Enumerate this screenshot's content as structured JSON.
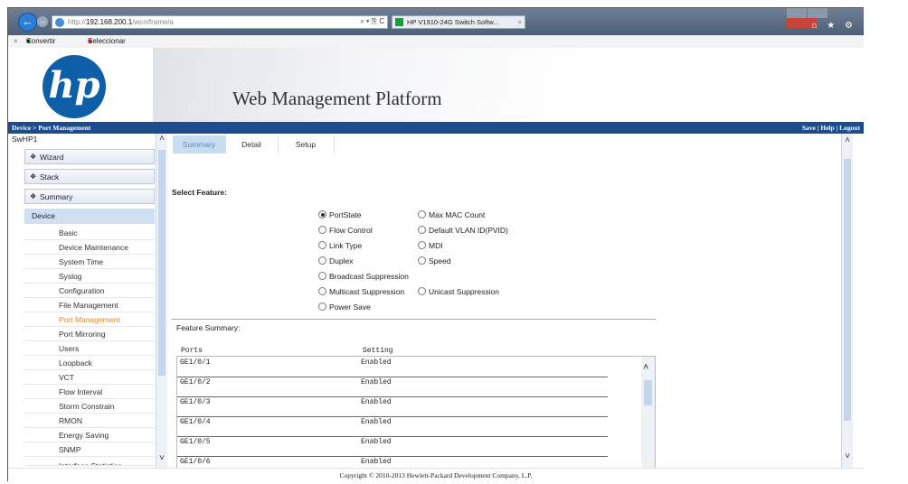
{
  "browser": {
    "url_prefix": "http://",
    "url_host": "192.168.200.1",
    "url_path": "/wcn/frame/a",
    "address_tools": "⌕ ▾ ⎘ C",
    "tab_title": "HP V1910-24G Switch Softw...",
    "tab_close": "×",
    "right_icons": "⌂ ★ ⚙",
    "toolbar_close": "×",
    "toolbar_convert": "Convertir",
    "toolbar_convert_arrow": "▾",
    "toolbar_select": "Seleccionar"
  },
  "header": {
    "logo_text": "hp",
    "title": "Web Management Platform"
  },
  "navbar": {
    "breadcrumb": "Device > Port Management",
    "links": "Save | Help | Logout"
  },
  "sidebar": {
    "device_name": "SwHP1",
    "groups": [
      "Wizard",
      "Stack",
      "Summary"
    ],
    "device_header": "Device",
    "items": [
      "Basic",
      "Device Maintenance",
      "System Time",
      "Syslog",
      "Configuration",
      "File Management",
      "Port Management",
      "Port Mirroring",
      "Users",
      "Loopback",
      "VCT",
      "Flow Interval",
      "Storm Constrain",
      "RMON",
      "Energy Saving",
      "SNMP",
      "Interface Statistics"
    ],
    "active_item": "Port Management"
  },
  "main": {
    "tabs": [
      "Summary",
      "Detail",
      "Setup"
    ],
    "active_tab": "Summary",
    "select_feature_label": "Select Feature:",
    "options_left": [
      "PortState",
      "Flow Control",
      "Link Type",
      "Duplex",
      "Broadcast Suppression",
      "Multicast Suppression",
      "Power Save"
    ],
    "options_right": [
      "Max MAC Count",
      "Default VLAN ID(PVID)",
      "MDI",
      "Speed",
      "",
      "Unicast Suppression"
    ],
    "selected_option": "PortState",
    "feature_summary_label": "Feature Summary:",
    "columns": [
      "Ports",
      "Setting"
    ],
    "rows": [
      {
        "port": "GE1/0/1",
        "setting": "Enabled"
      },
      {
        "port": "GE1/0/2",
        "setting": "Enabled"
      },
      {
        "port": "GE1/0/3",
        "setting": "Enabled"
      },
      {
        "port": "GE1/0/4",
        "setting": "Enabled"
      },
      {
        "port": "GE1/0/5",
        "setting": "Enabled"
      },
      {
        "port": "GE1/0/6",
        "setting": "Enabled"
      }
    ]
  },
  "scroll": {
    "up": "˄",
    "down": "˅"
  },
  "footer": {
    "copyright": "Copyright © 2010-2013 Hewlett-Packard Development Company, L.P."
  }
}
